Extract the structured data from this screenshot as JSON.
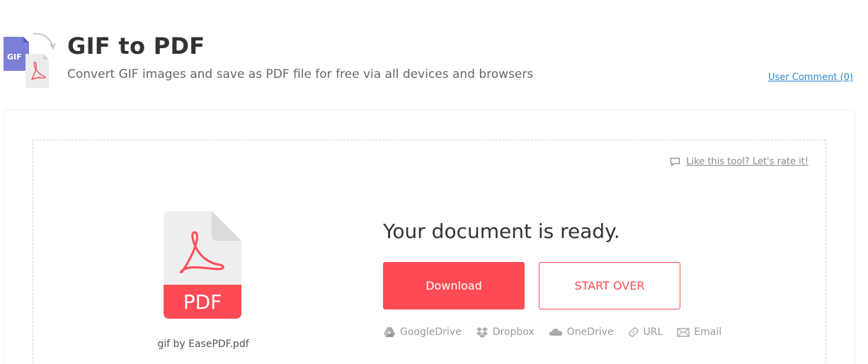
{
  "header": {
    "title": "GIF to PDF",
    "subtitle": "Convert GIF images and save as PDF file for free via all devices and browsers",
    "user_comment": "User Comment (0)",
    "icon_badge": "GIF"
  },
  "result": {
    "rate_link": "Like this tool? Let's rate it!",
    "file_label": "PDF",
    "filename": "gif by EasePDF.pdf",
    "ready_text": "Your document is ready.",
    "download_label": "Download",
    "start_over_label": "START OVER"
  },
  "share": [
    {
      "label": "GoogleDrive",
      "icon": "google-drive-icon"
    },
    {
      "label": "Dropbox",
      "icon": "dropbox-icon"
    },
    {
      "label": "OneDrive",
      "icon": "onedrive-icon"
    },
    {
      "label": "URL",
      "icon": "link-icon"
    },
    {
      "label": "Email",
      "icon": "email-icon"
    }
  ],
  "colors": {
    "accent": "#ff4b55",
    "link": "#2b8ad6",
    "gif_purple": "#7b7fd6"
  }
}
